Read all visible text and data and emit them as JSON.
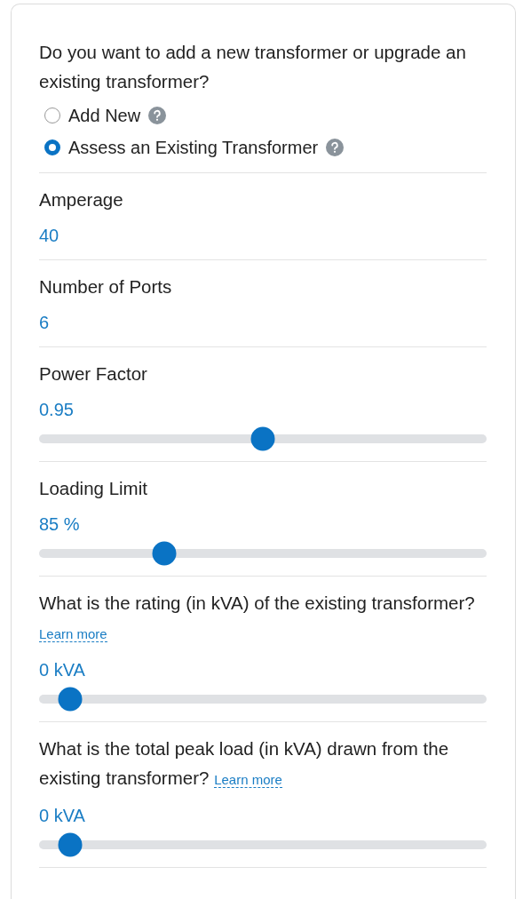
{
  "sections": [
    {
      "kind": "radio",
      "question": "Do you want to add a new transformer or upgrade an existing transformer?",
      "options": [
        {
          "label": "Add New",
          "selected": false
        },
        {
          "label": "Assess an Existing Transformer",
          "selected": true
        }
      ]
    },
    {
      "kind": "value",
      "label": "Amperage",
      "value": "40"
    },
    {
      "kind": "value",
      "label": "Number of Ports",
      "value": "6"
    },
    {
      "kind": "slider",
      "label": "Power Factor",
      "value": "0.95",
      "level": 0.5
    },
    {
      "kind": "slider",
      "label": "Loading Limit",
      "value": "85 %",
      "level": 0.28
    },
    {
      "kind": "slider",
      "label": "What is the rating (in kVA) of the existing transformer?",
      "link": "Learn more",
      "value": "0 kVA",
      "level": 0.07
    },
    {
      "kind": "slider",
      "label": "What is the total peak load (in kVA) drawn from the existing transformer?",
      "link": "Learn more",
      "value": "0 kVA",
      "level": 0.07
    }
  ]
}
